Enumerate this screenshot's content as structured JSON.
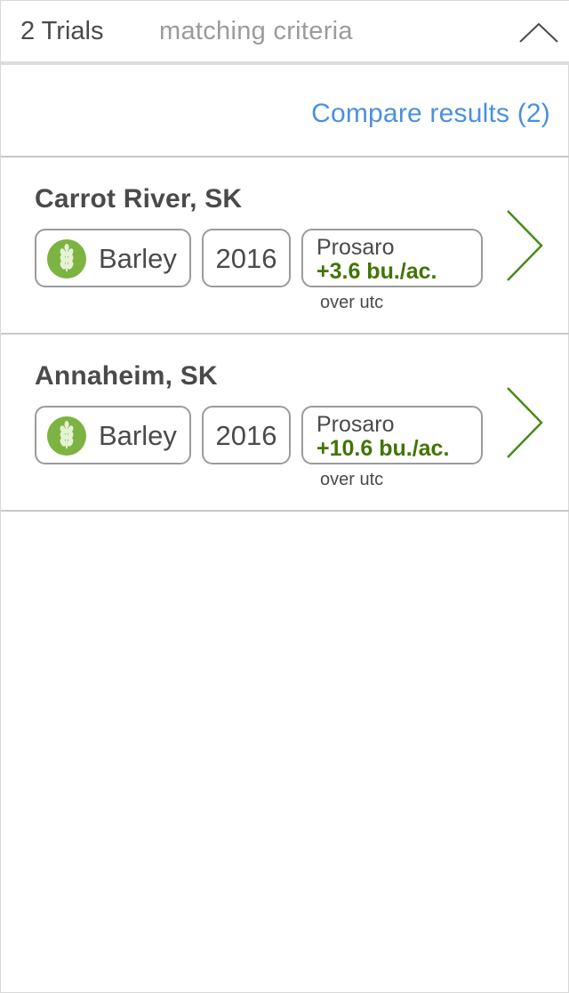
{
  "header": {
    "trial_count": "2 Trials",
    "criteria_label": "matching criteria",
    "collapse_icon": "chevron-up-icon"
  },
  "compare": {
    "label": "Compare results (2)"
  },
  "trials": [
    {
      "location": "Carrot River, SK",
      "crop": "Barley",
      "crop_icon": "wheat-icon",
      "year": "2016",
      "product": "Prosaro",
      "gain": "+3.6 bu./ac.",
      "comparison": "over utc"
    },
    {
      "location": "Annaheim, SK",
      "crop": "Barley",
      "crop_icon": "wheat-icon",
      "year": "2016",
      "product": "Prosaro",
      "gain": "+10.6 bu./ac.",
      "comparison": "over utc"
    }
  ],
  "colors": {
    "accent_link": "#4a90e2",
    "gain_green": "#417505",
    "crop_icon_green": "#7cb342",
    "chevron_green": "#4a8a1a"
  }
}
